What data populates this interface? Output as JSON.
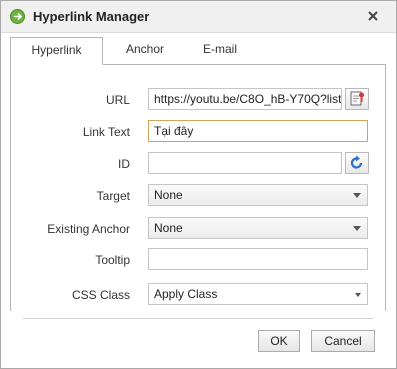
{
  "dialog": {
    "title": "Hyperlink Manager"
  },
  "tabs": [
    {
      "label": "Hyperlink",
      "active": true
    },
    {
      "label": "Anchor",
      "active": false
    },
    {
      "label": "E-mail",
      "active": false
    }
  ],
  "form": {
    "url_label": "URL",
    "url_value": "https://youtu.be/C8O_hB-Y70Q?list",
    "link_text_label": "Link Text",
    "link_text_value": "Tại đây",
    "id_label": "ID",
    "id_value": "",
    "target_label": "Target",
    "target_value": "None",
    "existing_anchor_label": "Existing Anchor",
    "existing_anchor_value": "None",
    "tooltip_label": "Tooltip",
    "tooltip_value": "",
    "css_class_label": "CSS Class",
    "css_class_value": "Apply Class"
  },
  "buttons": {
    "ok_label": "OK",
    "cancel_label": "Cancel"
  },
  "icons": {
    "app": "hyperlink-manager-icon",
    "close": "close-icon",
    "document_manager": "document-browse-icon",
    "refresh": "refresh-icon"
  },
  "colors": {
    "focused_border": "#d4a65a",
    "refresh_icon": "#2a6fc9"
  }
}
